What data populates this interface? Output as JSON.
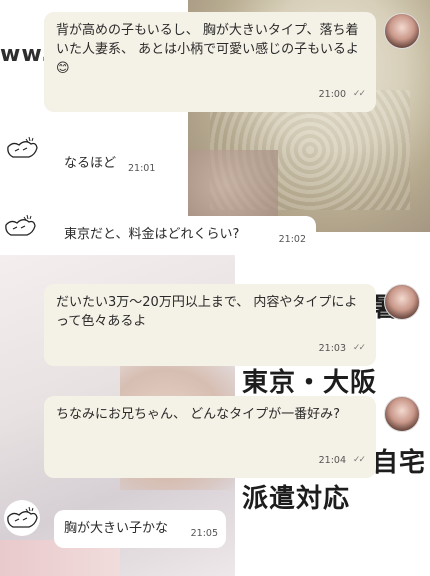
{
  "background_ad": {
    "www_text": "ww.s",
    "partial_text": "暑",
    "tokyo_osaka": "東京・大阪",
    "jitaku": "自宅",
    "haken": "派遣対応"
  },
  "messages": [
    {
      "sender": "girl",
      "text": "背が高めの子もいるし、 胸が大きいタイプ、落ち着いた人妻系、 あとは小柄で可愛い感じの子もいるよ😊",
      "time": "21:00",
      "status": "read"
    },
    {
      "sender": "guy",
      "text": "なるほど",
      "time": "21:01"
    },
    {
      "sender": "guy",
      "text": "東京だと、料金はどれくらい?",
      "time": "21:02"
    },
    {
      "sender": "girl",
      "text": "だいたい3万〜20万円以上まで、 内容やタイプによって色々あるよ",
      "time": "21:03",
      "status": "read"
    },
    {
      "sender": "girl",
      "text": "ちなみにお兄ちゃん、 どんなタイプが一番好み?",
      "time": "21:04",
      "status": "read"
    },
    {
      "sender": "guy",
      "text": "胸が大きい子かな",
      "time": "21:05"
    }
  ],
  "read_mark": "✓✓"
}
